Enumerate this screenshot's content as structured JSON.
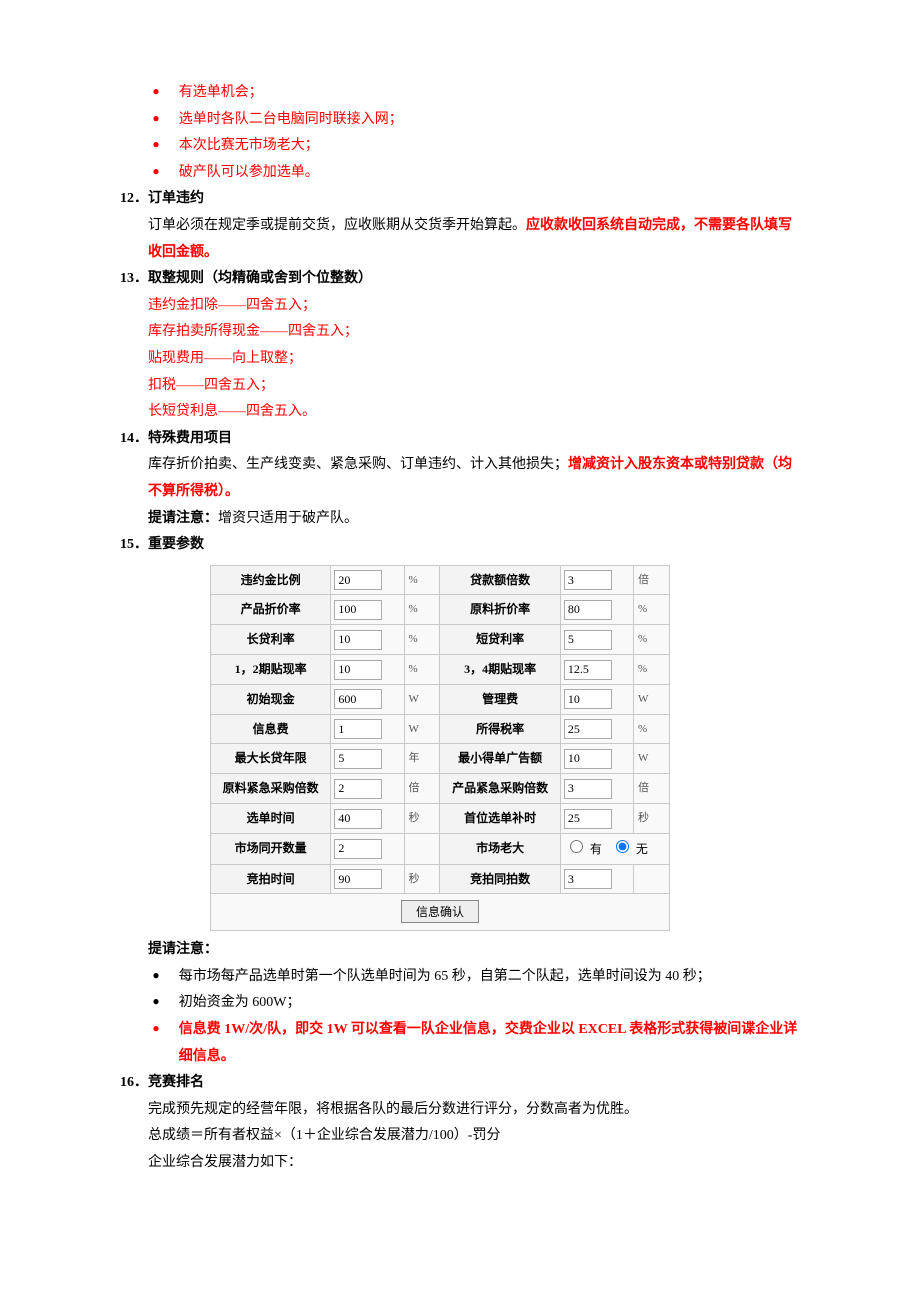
{
  "topBullets": [
    "有选单机会；",
    "选单时各队二台电脑同时联接入网；",
    "本次比赛无市场老大；",
    "破产队可以参加选单。"
  ],
  "s12": {
    "title": "12．订单违约",
    "line_pre": "订单必须在规定季或提前交货，应收账期从交货季开始算起。",
    "line_red": "应收款收回系统自动完成，不需要各队填写收回金额。"
  },
  "s13": {
    "title": "13．取整规则（均精确或舍到个位整数）",
    "items": [
      "违约金扣除——四舍五入；",
      "库存拍卖所得现金——四舍五入；",
      "贴现费用——向上取整；",
      "扣税——四舍五入；",
      "长短贷利息——四舍五入。"
    ]
  },
  "s14": {
    "title": "14．特殊费用项目",
    "line_pre": "库存折价拍卖、生产线变卖、紧急采购、订单违约、计入其他损失；",
    "line_red": "增减资计入股东资本或特别贷款（均不算所得税）。",
    "note_label": "提请注意：",
    "note_text": "增资只适用于破产队。"
  },
  "s15": {
    "title": "15．重要参数",
    "params": {
      "r1": {
        "l1": "违约金比例",
        "v1": "20",
        "u1": "%",
        "l2": "贷款额倍数",
        "v2": "3",
        "u2": "倍"
      },
      "r2": {
        "l1": "产品折价率",
        "v1": "100",
        "u1": "%",
        "l2": "原料折价率",
        "v2": "80",
        "u2": "%"
      },
      "r3": {
        "l1": "长贷利率",
        "v1": "10",
        "u1": "%",
        "l2": "短贷利率",
        "v2": "5",
        "u2": "%"
      },
      "r4": {
        "l1": "1，2期贴现率",
        "v1": "10",
        "u1": "%",
        "l2": "3，4期贴现率",
        "v2": "12.5",
        "u2": "%"
      },
      "r5": {
        "l1": "初始现金",
        "v1": "600",
        "u1": "W",
        "l2": "管理费",
        "v2": "10",
        "u2": "W"
      },
      "r6": {
        "l1": "信息费",
        "v1": "1",
        "u1": "W",
        "l2": "所得税率",
        "v2": "25",
        "u2": "%"
      },
      "r7": {
        "l1": "最大长贷年限",
        "v1": "5",
        "u1": "年",
        "l2": "最小得单广告额",
        "v2": "10",
        "u2": "W"
      },
      "r8": {
        "l1": "原料紧急采购倍数",
        "v1": "2",
        "u1": "倍",
        "l2": "产品紧急采购倍数",
        "v2": "3",
        "u2": "倍"
      },
      "r9": {
        "l1": "选单时间",
        "v1": "40",
        "u1": "秒",
        "l2": "首位选单补时",
        "v2": "25",
        "u2": "秒"
      },
      "r10": {
        "l1": "市场同开数量",
        "v1": "2",
        "u1": "",
        "l2": "市场老大",
        "opt_yes": "有",
        "opt_no": "无"
      },
      "r11": {
        "l1": "竞拍时间",
        "v1": "90",
        "u1": "秒",
        "l2": "竞拍同拍数",
        "v2": "3",
        "u2": ""
      }
    },
    "confirm": "信息确认",
    "noteLabel": "提请注意：",
    "bullets": [
      {
        "text": "每市场每产品选单时第一个队选单时间为 65 秒，自第二个队起，选单时间设为 40 秒；",
        "red": false
      },
      {
        "text": "初始资金为 600W；",
        "red": false
      },
      {
        "text": "信息费 1W/次/队，即交 1W 可以查看一队企业信息，交费企业以 EXCEL 表格形式获得被间谍企业详细信息。",
        "red": true
      }
    ]
  },
  "s16": {
    "title": "16．竞赛排名",
    "lines": [
      "完成预先规定的经营年限，将根据各队的最后分数进行评分，分数高者为优胜。",
      "总成绩＝所有者权益×（1＋企业综合发展潜力/100）-罚分",
      "企业综合发展潜力如下："
    ]
  }
}
